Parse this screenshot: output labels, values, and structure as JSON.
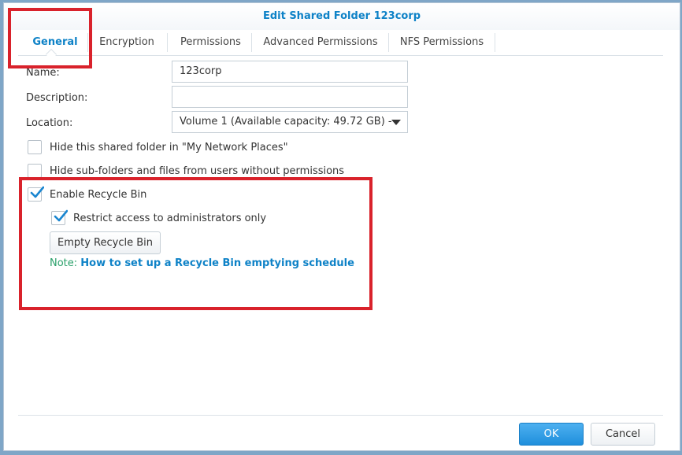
{
  "dialog": {
    "title": "Edit Shared Folder 123corp"
  },
  "tabs": [
    {
      "label": "General",
      "active": true
    },
    {
      "label": "Encryption",
      "active": false
    },
    {
      "label": "Permissions",
      "active": false
    },
    {
      "label": "Advanced Permissions",
      "active": false
    },
    {
      "label": "NFS Permissions",
      "active": false
    }
  ],
  "form": {
    "name_label": "Name:",
    "name_value": "123corp",
    "description_label": "Description:",
    "description_value": "",
    "location_label": "Location:",
    "location_value": "Volume 1 (Available capacity: 49.72 GB) -",
    "hide_folder_label": "Hide this shared folder in \"My Network Places\"",
    "hide_folder_checked": false,
    "hide_subfolders_label": "Hide sub-folders and files from users without permissions",
    "hide_subfolders_checked": false,
    "recycle_bin_label": "Enable Recycle Bin",
    "recycle_bin_checked": true,
    "restrict_label": "Restrict access to administrators only",
    "restrict_checked": true,
    "empty_recycle_label": "Empty Recycle Bin",
    "note_label": "Note:",
    "note_link": "How to set up a Recycle Bin emptying schedule"
  },
  "footer": {
    "ok_label": "OK",
    "cancel_label": "Cancel"
  },
  "colors": {
    "accent": "#0e82c7",
    "highlight": "#d9222b",
    "note_green": "#2aa06a",
    "primary_button": "#1f8fdc"
  }
}
